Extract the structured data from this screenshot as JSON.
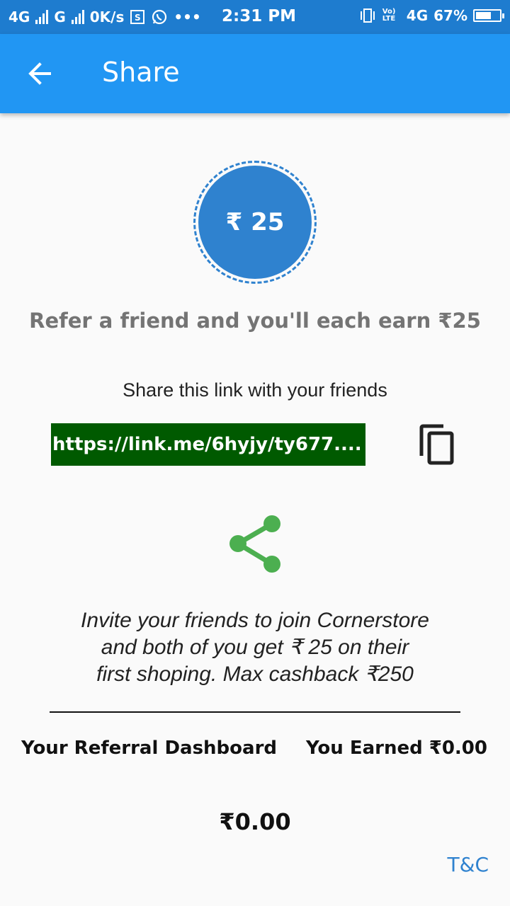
{
  "status_bar": {
    "network1": "4G",
    "network2": "G",
    "speed": "0K/s",
    "time": "2:31 PM",
    "volte": "Vo) LTE",
    "network3": "4G",
    "battery_percent": "67%",
    "battery_level": 0.67
  },
  "app_bar": {
    "title": "Share",
    "back_icon": "arrow-left-icon"
  },
  "reward_badge": {
    "amount": "₹ 25"
  },
  "headline": "Refer a friend and you'll each earn ₹25",
  "share": {
    "label": "Share this link with your friends",
    "link": "https://link.me/6hyjy/ty677....",
    "copy_icon": "copy-icon",
    "share_icon": "share-icon"
  },
  "invite": {
    "line1": "Invite your friends to join Cornerstore",
    "line2": "and both of you get ₹ 25 on their",
    "line3": "first shoping. Max cashback ₹250"
  },
  "dashboard": {
    "label": "Your Referral Dashboard",
    "earned": "You Earned ₹0.00",
    "total": "₹0.00"
  },
  "tnc": "T&C",
  "colors": {
    "app_bar": "#2196f3",
    "status_bar": "#1e7ccf",
    "badge": "#2f82cf",
    "link_bg": "#005a00",
    "share_icon": "#4caf50"
  }
}
